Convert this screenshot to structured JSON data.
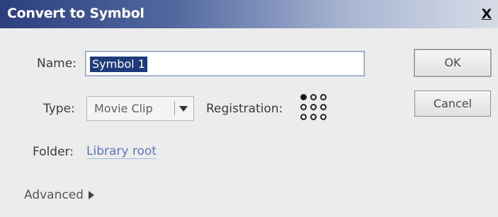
{
  "dialog": {
    "title": "Convert to Symbol",
    "close_label": "X"
  },
  "form": {
    "name_label": "Name:",
    "name_value": "Symbol 1",
    "type_label": "Type:",
    "type_value": "Movie Clip",
    "registration_label": "Registration:",
    "registration_selected": "top-left",
    "folder_label": "Folder:",
    "folder_link": "Library root",
    "advanced_label": "Advanced"
  },
  "buttons": {
    "ok": "OK",
    "cancel": "Cancel"
  },
  "colors": {
    "title_bar_start": "#2b3f7e",
    "selection": "#1f3b7c",
    "link": "#5a76b8",
    "background": "#ececec"
  }
}
